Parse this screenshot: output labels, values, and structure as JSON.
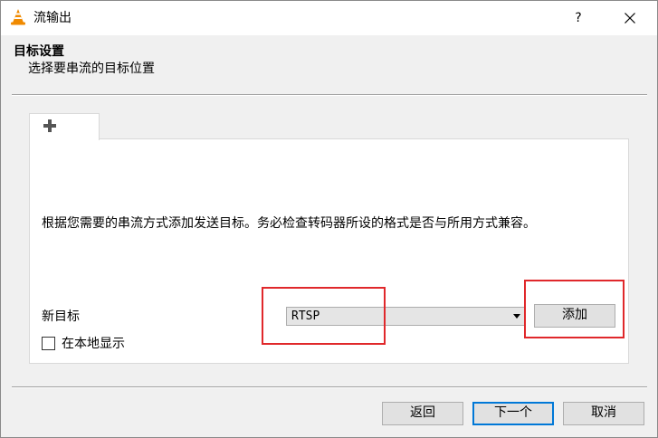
{
  "window": {
    "title": "流输出",
    "help_label": "?",
    "icons": {
      "app": "vlc-cone-icon",
      "close": "close-icon"
    }
  },
  "header": {
    "title": "目标设置",
    "subtitle": "选择要串流的目标位置"
  },
  "tab": {
    "icon": "plus-icon"
  },
  "panel": {
    "description": "根据您需要的串流方式添加发送目标。务必检查转码器所设的格式是否与所用方式兼容。",
    "new_target_label": "新目标",
    "target_select": {
      "selected": "RTSP"
    },
    "add_button": "添加",
    "display_locally": {
      "label": "在本地显示",
      "checked": false
    }
  },
  "footer": {
    "back_label": "返回",
    "next_label": "下一个",
    "cancel_label": "取消"
  },
  "colors": {
    "annotation_red": "#e0282b",
    "focus_blue": "#0078d7",
    "vlc_orange": "#f08a00"
  }
}
